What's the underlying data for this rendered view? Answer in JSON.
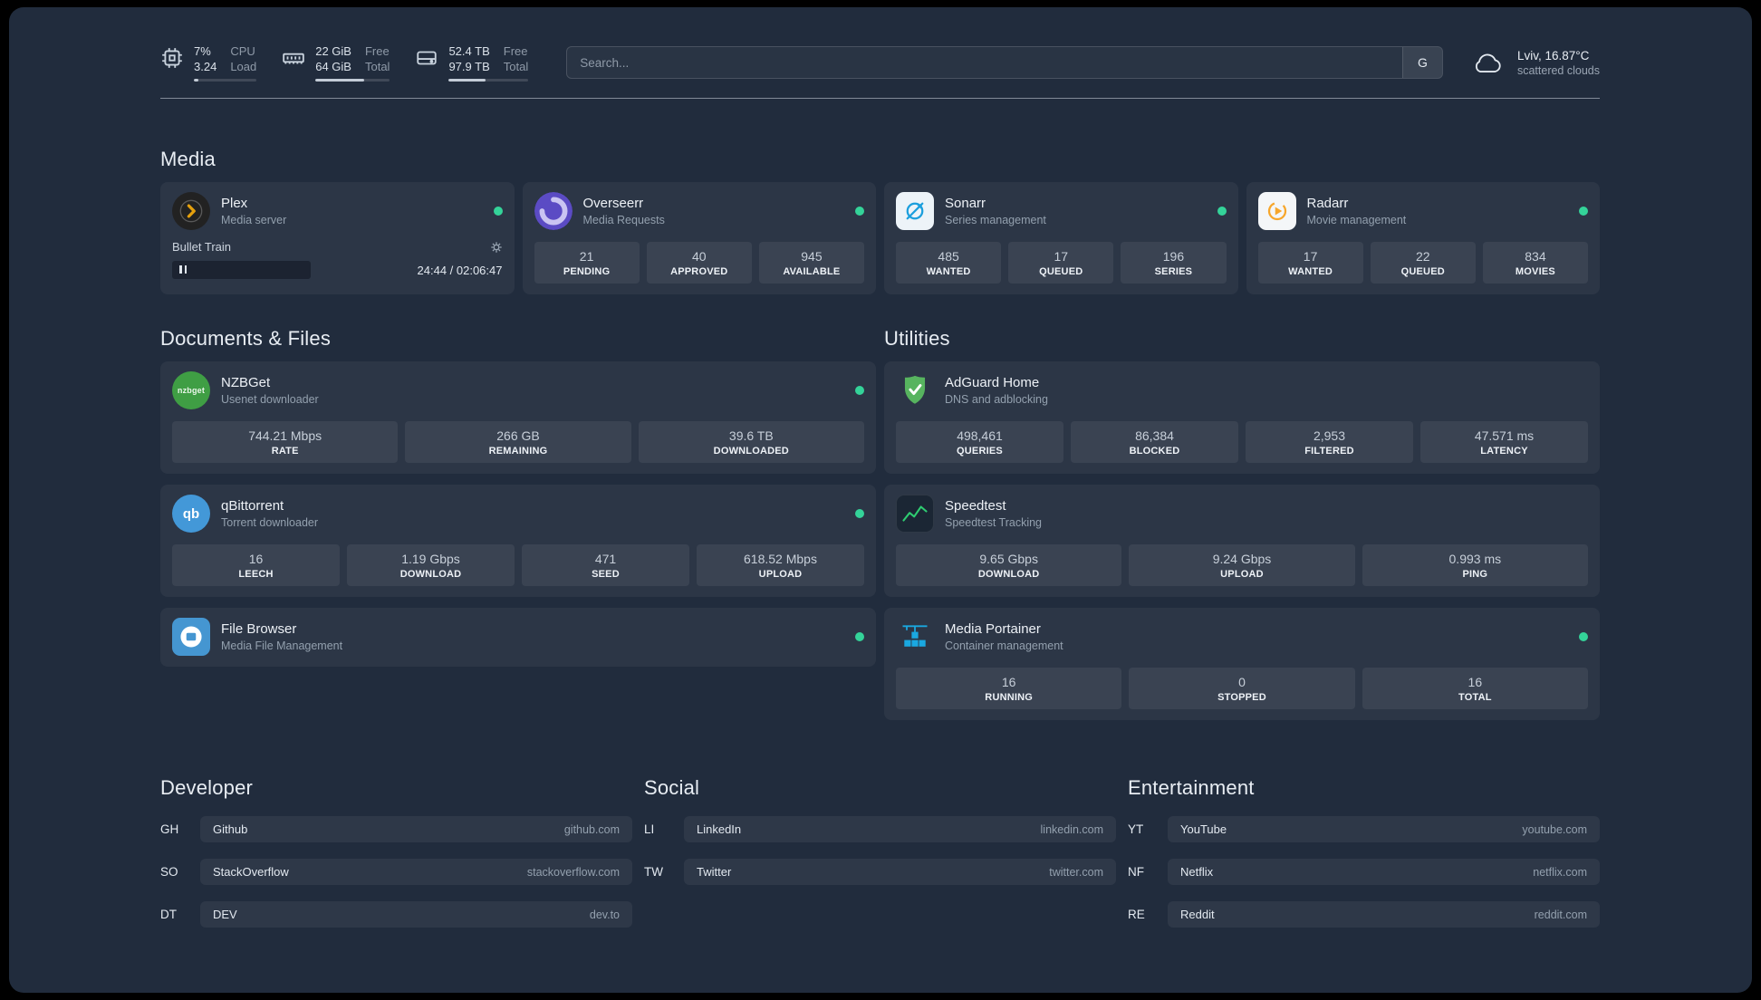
{
  "colors": {
    "background": "#212c3d",
    "status_online_green": "#34d399",
    "plex_amber": "#e5a00d",
    "overseerr_purple": "#5b4bc4",
    "sonarr_blue": "#1c9fdd",
    "radarr_amber": "#f7a62b",
    "nzbget_green": "#3f9e44",
    "qbittorrent_blue": "#4398d8",
    "filebrowser_blue": "#4596d1",
    "adguard_green": "#57b45f",
    "speedtest_green": "#2ecc71",
    "portainer_blue": "#1aa8e0"
  },
  "icons": {
    "topbar": [
      "cpu-icon",
      "memory-icon",
      "disk-icon"
    ],
    "weather": "cloud-icon",
    "nzbget_label": "nzbget",
    "qbittorrent_label": "qb"
  },
  "topbar": {
    "cpu": {
      "value1": "7%",
      "value2": "3.24",
      "label1": "CPU",
      "label2": "Load",
      "used_pct": 7
    },
    "memory": {
      "value1": "22 GiB",
      "value2": "64 GiB",
      "label1": "Free",
      "label2": "Total",
      "used_pct": 66
    },
    "disk": {
      "value1": "52.4 TB",
      "value2": "97.9 TB",
      "label1": "Free",
      "label2": "Total",
      "used_pct": 46
    },
    "search": {
      "placeholder": "Search...",
      "provider": "G"
    },
    "weather": {
      "location": "Lviv, 16.87°C",
      "condition": "scattered clouds"
    }
  },
  "sections": {
    "media": {
      "title": "Media",
      "plex": {
        "name": "Plex",
        "subtitle": "Media server",
        "now_playing": "Bullet Train",
        "time": "24:44 / 02:06:47",
        "online": true
      },
      "overseerr": {
        "name": "Overseerr",
        "subtitle": "Media Requests",
        "online": true,
        "stats": [
          {
            "value": "21",
            "label": "PENDING"
          },
          {
            "value": "40",
            "label": "APPROVED"
          },
          {
            "value": "945",
            "label": "AVAILABLE"
          }
        ]
      },
      "sonarr": {
        "name": "Sonarr",
        "subtitle": "Series management",
        "online": true,
        "stats": [
          {
            "value": "485",
            "label": "WANTED"
          },
          {
            "value": "17",
            "label": "QUEUED"
          },
          {
            "value": "196",
            "label": "SERIES"
          }
        ]
      },
      "radarr": {
        "name": "Radarr",
        "subtitle": "Movie management",
        "online": true,
        "stats": [
          {
            "value": "17",
            "label": "WANTED"
          },
          {
            "value": "22",
            "label": "QUEUED"
          },
          {
            "value": "834",
            "label": "MOVIES"
          }
        ]
      }
    },
    "documents": {
      "title": "Documents & Files",
      "nzbget": {
        "name": "NZBGet",
        "subtitle": "Usenet downloader",
        "online": true,
        "stats": [
          {
            "value": "744.21 Mbps",
            "label": "RATE"
          },
          {
            "value": "266 GB",
            "label": "REMAINING"
          },
          {
            "value": "39.6 TB",
            "label": "DOWNLOADED"
          }
        ]
      },
      "qbittorrent": {
        "name": "qBittorrent",
        "subtitle": "Torrent downloader",
        "online": true,
        "stats": [
          {
            "value": "16",
            "label": "LEECH"
          },
          {
            "value": "1.19 Gbps",
            "label": "DOWNLOAD"
          },
          {
            "value": "471",
            "label": "SEED"
          },
          {
            "value": "618.52 Mbps",
            "label": "UPLOAD"
          }
        ]
      },
      "filebrowser": {
        "name": "File Browser",
        "subtitle": "Media File Management",
        "online": true
      }
    },
    "utilities": {
      "title": "Utilities",
      "adguard": {
        "name": "AdGuard Home",
        "subtitle": "DNS and adblocking",
        "stats": [
          {
            "value": "498,461",
            "label": "QUERIES"
          },
          {
            "value": "86,384",
            "label": "BLOCKED"
          },
          {
            "value": "2,953",
            "label": "FILTERED"
          },
          {
            "value": "47.571 ms",
            "label": "LATENCY"
          }
        ]
      },
      "speedtest": {
        "name": "Speedtest",
        "subtitle": "Speedtest Tracking",
        "stats": [
          {
            "value": "9.65 Gbps",
            "label": "DOWNLOAD"
          },
          {
            "value": "9.24 Gbps",
            "label": "UPLOAD"
          },
          {
            "value": "0.993 ms",
            "label": "PING"
          }
        ]
      },
      "portainer": {
        "name": "Media Portainer",
        "subtitle": "Container management",
        "online": true,
        "stats": [
          {
            "value": "16",
            "label": "RUNNING"
          },
          {
            "value": "0",
            "label": "STOPPED"
          },
          {
            "value": "16",
            "label": "TOTAL"
          }
        ]
      }
    }
  },
  "bookmarks": {
    "developer": {
      "title": "Developer",
      "items": [
        {
          "abbr": "GH",
          "name": "Github",
          "domain": "github.com"
        },
        {
          "abbr": "SO",
          "name": "StackOverflow",
          "domain": "stackoverflow.com"
        },
        {
          "abbr": "DT",
          "name": "DEV",
          "domain": "dev.to"
        }
      ]
    },
    "social": {
      "title": "Social",
      "items": [
        {
          "abbr": "LI",
          "name": "LinkedIn",
          "domain": "linkedin.com"
        },
        {
          "abbr": "TW",
          "name": "Twitter",
          "domain": "twitter.com"
        }
      ]
    },
    "entertainment": {
      "title": "Entertainment",
      "items": [
        {
          "abbr": "YT",
          "name": "YouTube",
          "domain": "youtube.com"
        },
        {
          "abbr": "NF",
          "name": "Netflix",
          "domain": "netflix.com"
        },
        {
          "abbr": "RE",
          "name": "Reddit",
          "domain": "reddit.com"
        }
      ]
    }
  }
}
